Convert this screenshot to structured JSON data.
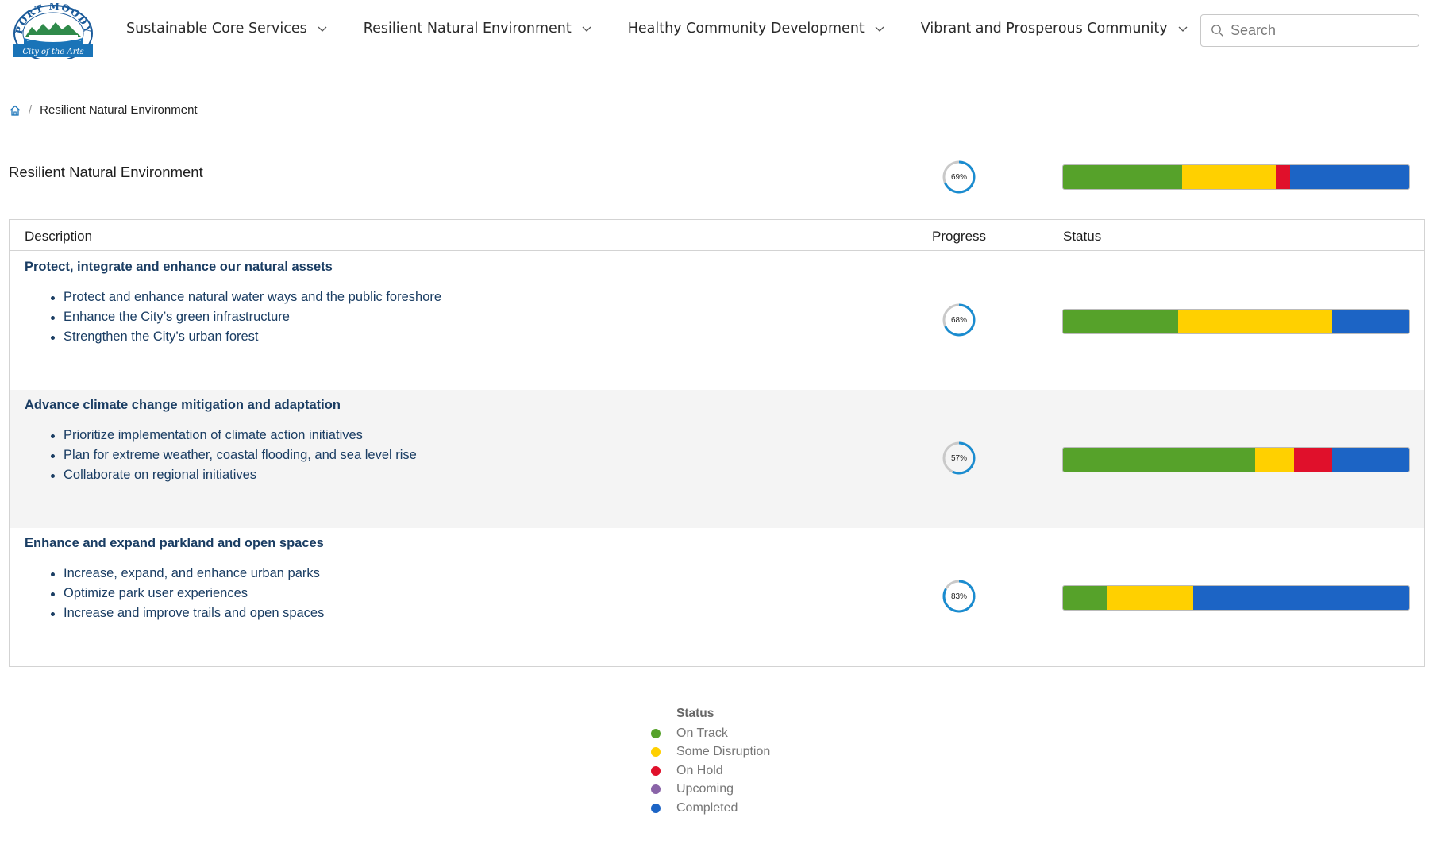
{
  "header": {
    "logo_text_top": "PORT MOODY",
    "logo_text_bottom": "City of the Arts",
    "nav": [
      {
        "label": "Sustainable Core Services"
      },
      {
        "label": "Resilient Natural Environment"
      },
      {
        "label": "Healthy Community Development"
      },
      {
        "label": "Vibrant and Prosperous Community"
      }
    ],
    "search_placeholder": "Search"
  },
  "breadcrumb": {
    "current": "Resilient Natural Environment",
    "separator": "/"
  },
  "summary": {
    "title": "Resilient Natural Environment",
    "progress_label": "69%",
    "progress_value": 0.69,
    "status_fractions": {
      "on_track": 0.345,
      "some_disruption": 0.27,
      "on_hold": 0.04,
      "upcoming": 0.0,
      "completed": 0.345
    }
  },
  "table": {
    "headers": {
      "description": "Description",
      "progress": "Progress",
      "status": "Status"
    },
    "rows": [
      {
        "title": "Protect, integrate and enhance our natural assets",
        "items": [
          "Protect and enhance natural water ways and the public foreshore",
          "Enhance the City’s green infrastructure",
          " Strengthen the City’s urban forest"
        ],
        "progress_label": "68%",
        "progress_value": 0.68,
        "status_fractions": {
          "on_track": 0.333,
          "some_disruption": 0.445,
          "on_hold": 0.0,
          "upcoming": 0.0,
          "completed": 0.222
        }
      },
      {
        "title": "Advance climate change mitigation and adaptation",
        "items": [
          "Prioritize implementation of climate action initiatives",
          "Plan for extreme weather, coastal flooding, and sea level rise",
          "Collaborate on regional initiatives"
        ],
        "progress_label": "57%",
        "progress_value": 0.57,
        "status_fractions": {
          "on_track": 0.556,
          "some_disruption": 0.111,
          "on_hold": 0.111,
          "upcoming": 0.0,
          "completed": 0.222
        }
      },
      {
        "title": "Enhance and expand parkland and open spaces",
        "items": [
          "Increase, expand, and enhance urban parks",
          "Optimize park user experiences",
          "Increase and improve trails and open spaces"
        ],
        "progress_label": "83%",
        "progress_value": 0.83,
        "status_fractions": {
          "on_track": 0.125,
          "some_disruption": 0.25,
          "on_hold": 0.0,
          "upcoming": 0.0,
          "completed": 0.625
        }
      }
    ]
  },
  "legend": {
    "title": "Status",
    "items": [
      {
        "key": "on_track",
        "label": "On Track",
        "color": "#56a22a"
      },
      {
        "key": "some_disruption",
        "label": "Some Disruption",
        "color": "#ffd000"
      },
      {
        "key": "on_hold",
        "label": "On Hold",
        "color": "#e0102b"
      },
      {
        "key": "upcoming",
        "label": "Upcoming",
        "color": "#8a64a8"
      },
      {
        "key": "completed",
        "label": "Completed",
        "color": "#1c64c5"
      }
    ]
  },
  "colors": {
    "ring_progress": "#1a8cd0",
    "ring_track": "#c9c9c9"
  }
}
